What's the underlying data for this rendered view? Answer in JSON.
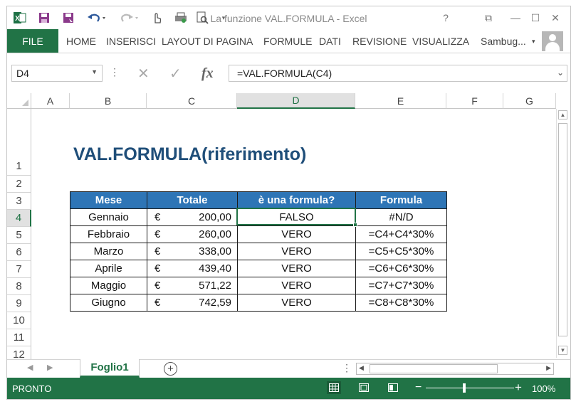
{
  "window": {
    "title": "La funzione VAL.FORMULA - Excel"
  },
  "title_buttons": {
    "help": "?",
    "restore": "⧉",
    "minimize": "—",
    "maximize": "☐",
    "close": "✕"
  },
  "ribbon": {
    "file": "FILE",
    "tabs": [
      "HOME",
      "INSERISCI",
      "LAYOUT DI PAGINA",
      "FORMULE",
      "DATI",
      "REVISIONE",
      "VISUALIZZA"
    ],
    "user": "Sambug..."
  },
  "formula_bar": {
    "name_box": "D4",
    "cancel": "✕",
    "enter": "✓",
    "fx": "fx",
    "formula": "=VAL.FORMULA(C4)"
  },
  "columns": [
    "A",
    "B",
    "C",
    "D",
    "E",
    "F",
    "G"
  ],
  "rows": [
    "1",
    "2",
    "3",
    "4",
    "5",
    "6",
    "7",
    "8",
    "9",
    "10",
    "11",
    "12"
  ],
  "sheet": {
    "heading": "VAL.FORMULA(riferimento)",
    "table_headers": [
      "Mese",
      "Totale",
      "è una formula?",
      "Formula"
    ],
    "currency": "€",
    "table_rows": [
      {
        "mese": "Gennaio",
        "totale": "200,00",
        "is_formula": "FALSO",
        "formula": "#N/D"
      },
      {
        "mese": "Febbraio",
        "totale": "260,00",
        "is_formula": "VERO",
        "formula": "=C4+C4*30%"
      },
      {
        "mese": "Marzo",
        "totale": "338,00",
        "is_formula": "VERO",
        "formula": "=C5+C5*30%"
      },
      {
        "mese": "Aprile",
        "totale": "439,40",
        "is_formula": "VERO",
        "formula": "=C6+C6*30%"
      },
      {
        "mese": "Maggio",
        "totale": "571,22",
        "is_formula": "VERO",
        "formula": "=C7+C7*30%"
      },
      {
        "mese": "Giugno",
        "totale": "742,59",
        "is_formula": "VERO",
        "formula": "=C8+C8*30%"
      }
    ]
  },
  "sheet_tabs": {
    "active": "Foglio1",
    "add": "+"
  },
  "status": {
    "mode": "PRONTO",
    "zoom": "100%",
    "zoom_minus": "−",
    "zoom_plus": "+"
  }
}
